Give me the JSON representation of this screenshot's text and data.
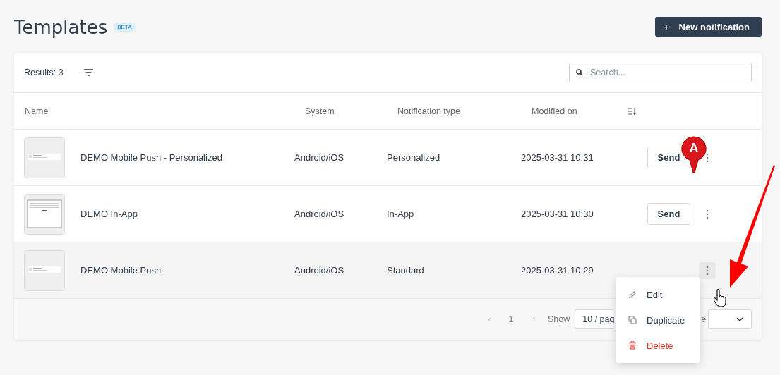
{
  "page": {
    "title": "Templates",
    "badge": "BETA",
    "new_button": "New notification",
    "new_button_icon": "+"
  },
  "toolbar": {
    "results": "Results: 3",
    "search": {
      "placeholder": "Search..."
    }
  },
  "table": {
    "columns": [
      "Name",
      "System",
      "Notification type",
      "Modified on"
    ],
    "rows": [
      {
        "name": "DEMO Mobile Push - Personalized",
        "kind": "push",
        "system": "Android/iOS",
        "type": "Personalized",
        "modified": "2025-03-31 10:31",
        "send": "Send",
        "hovered": false
      },
      {
        "name": "DEMO In-App",
        "kind": "inapp",
        "system": "Android/iOS",
        "type": "In-App",
        "modified": "2025-03-31 10:30",
        "send": "Send",
        "hovered": false
      },
      {
        "name": "DEMO Mobile Push",
        "kind": "push",
        "system": "Android/iOS",
        "type": "Standard",
        "modified": "2025-03-31 10:29",
        "hovered": true
      }
    ]
  },
  "pagination": {
    "prev": "‹",
    "page": "1",
    "next": "›",
    "show_label": "Show",
    "page_size": "10 / pag",
    "goto_fragment": "e"
  },
  "context_menu": {
    "items": [
      {
        "label": "Edit",
        "kind": "edit"
      },
      {
        "label": "Duplicate",
        "kind": "duplicate"
      },
      {
        "label": "Delete",
        "kind": "delete"
      }
    ]
  },
  "annotation": {
    "marker": "A"
  }
}
